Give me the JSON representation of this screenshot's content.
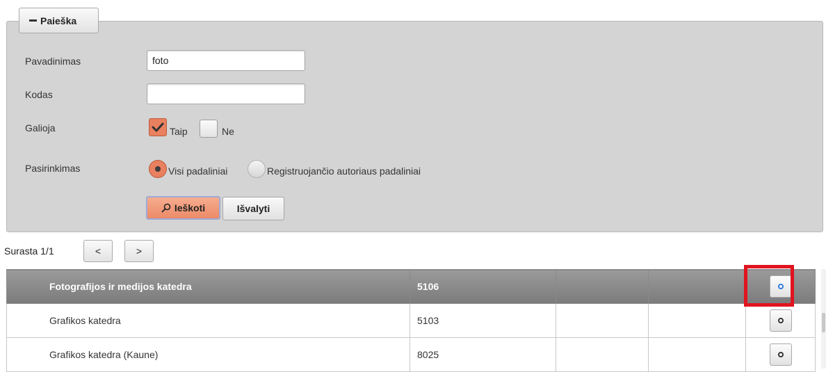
{
  "search": {
    "legend": "Paieška",
    "fields": {
      "name_label": "Pavadinimas",
      "name_value": "foto",
      "code_label": "Kodas",
      "code_value": "",
      "valid_label": "Galioja",
      "valid_yes_label": "Taip",
      "valid_yes_checked": true,
      "valid_no_label": "Ne",
      "valid_no_checked": false,
      "choice_label": "Pasirinkimas",
      "choice_option1": "Visi padaliniai",
      "choice_option2": "Registruojančio autoriaus padaliniai",
      "choice_selected": "Visi padaliniai"
    },
    "search_button": "Ieškoti",
    "clear_button": "Išvalyti"
  },
  "pager": {
    "text": "Surasta 1/1",
    "prev": "<",
    "next": ">"
  },
  "table": {
    "rows": [
      {
        "name": "Fotografijos ir medijos katedra",
        "code": "5106",
        "col3": "",
        "col4": "",
        "selected": true
      },
      {
        "name": "Grafikos katedra",
        "code": "5103",
        "col3": "",
        "col4": "",
        "selected": false
      },
      {
        "name": "Grafikos katedra (Kaune)",
        "code": "8025",
        "col3": "",
        "col4": "",
        "selected": false
      }
    ]
  },
  "colors": {
    "accent": "#e9805f",
    "panel": "#d4d4d4",
    "selected_row": "#8a8a8a",
    "highlight": "#e0141e"
  }
}
